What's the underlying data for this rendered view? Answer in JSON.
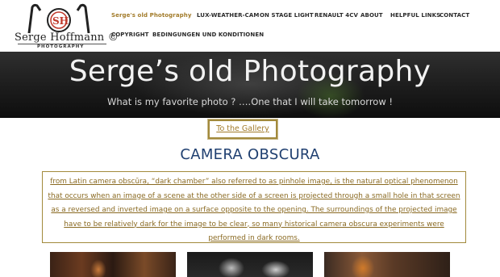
{
  "logo": {
    "name": "Serge Hoffmann ©",
    "sub": "Photography",
    "mark": "SH"
  },
  "nav": {
    "items": [
      "Serge's old Photography",
      "Lux-Weather-Cam",
      "On Stage Light",
      "Renault 4CV",
      "About",
      "Helpful Links",
      "Contact",
      "Copyright",
      "Bedingungen und Konditionen"
    ]
  },
  "hero": {
    "title": "Serge’s old Photography",
    "subtitle": "What is my favorite photo ? ….One that I will take tomorrow !"
  },
  "gallery_button": "To the Gallery",
  "section_title": "CAMERA OBSCURA",
  "description": "from Latin camera obscūra, “dark chamber” also referred to as pinhole image, is the natural optical phenomenon that occurs when an image of a scene at the other side of a screen is projected through a small hole in that screen as a reversed and inverted image on a surface opposite to the opening. The surroundings of the projected image have to be relatively dark for the image to be clear, so many historical camera obscura experiments were performed in dark rooms.",
  "colors": {
    "accent": "#a27b2a",
    "title_blue": "#1f3f70",
    "border_gold": "#a28a3c"
  }
}
